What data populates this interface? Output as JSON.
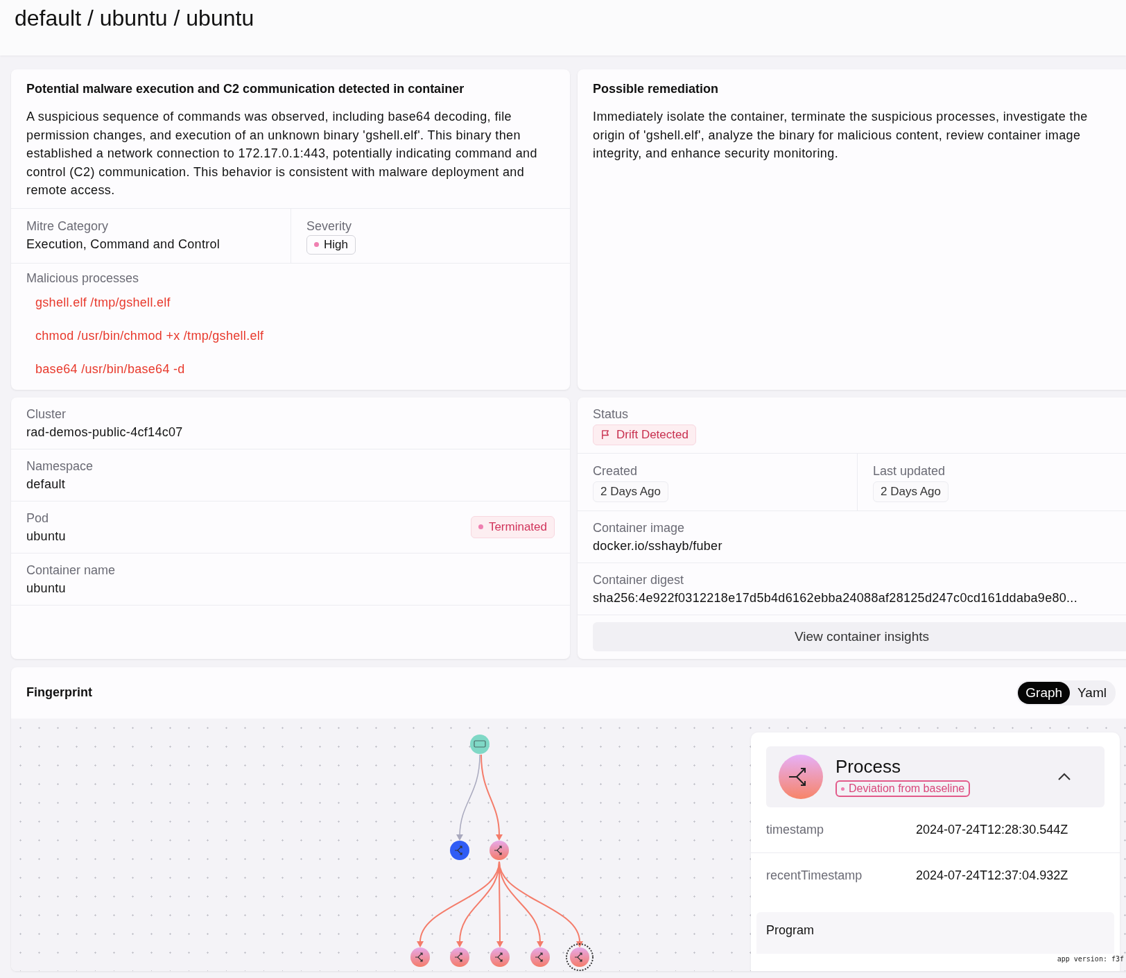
{
  "header": {
    "breadcrumb": "default / ubuntu / ubuntu"
  },
  "alert": {
    "title": "Potential malware execution and C2 communication detected in container",
    "description": "A suspicious sequence of commands was observed, including base64 decoding, file permission changes, and execution of an unknown binary 'gshell.elf'. This binary then established a network connection to 172.17.0.1:443, potentially indicating command and control (C2) communication. This behavior is consistent with malware deployment and remote access.",
    "mitre": {
      "label": "Mitre Category",
      "value": "Execution, Command and Control"
    },
    "severity": {
      "label": "Severity",
      "value": "High"
    },
    "processes": {
      "label": "Malicious processes",
      "items": [
        "gshell.elf /tmp/gshell.elf",
        "chmod /usr/bin/chmod +x /tmp/gshell.elf",
        "base64 /usr/bin/base64 -d"
      ]
    }
  },
  "remediation": {
    "title": "Possible remediation",
    "text": "Immediately isolate the container, terminate the suspicious processes, investigate the origin of 'gshell.elf', analyze the binary for malicious content, review container image integrity, and enhance security monitoring."
  },
  "workload": {
    "fields": [
      {
        "label": "Cluster",
        "value": "rad-demos-public-4cf14c07"
      },
      {
        "label": "Namespace",
        "value": "default"
      },
      {
        "label": "Pod",
        "value": "ubuntu",
        "badge": "Terminated"
      },
      {
        "label": "Container name",
        "value": "ubuntu"
      }
    ]
  },
  "container": {
    "status": {
      "label": "Status",
      "value": "Drift Detected"
    },
    "created": {
      "label": "Created",
      "value": "2 Days Ago"
    },
    "last_updated": {
      "label": "Last updated",
      "value": "2 Days Ago"
    },
    "image": {
      "label": "Container image",
      "value": "docker.io/sshayb/fuber"
    },
    "digest": {
      "label": "Container digest",
      "value": "sha256:4e922f0312218e17d5b4d6162ebba24088af28125d247c0cd161ddaba9e80..."
    },
    "insights_button": "View container insights"
  },
  "fingerprint": {
    "title": "Fingerprint",
    "views": [
      {
        "label": "Graph",
        "selected": true
      },
      {
        "label": "Yaml",
        "selected": false
      }
    ],
    "details": {
      "title": "Process",
      "badge": "Deviation from baseline",
      "expanded": true,
      "fields": [
        {
          "key": "timestamp",
          "value": "2024-07-24T12:28:30.544Z"
        },
        {
          "key": "recentTimestamp",
          "value": "2024-07-24T12:37:04.932Z"
        }
      ],
      "section": "Program"
    }
  },
  "app_version": "app version: f3f"
}
